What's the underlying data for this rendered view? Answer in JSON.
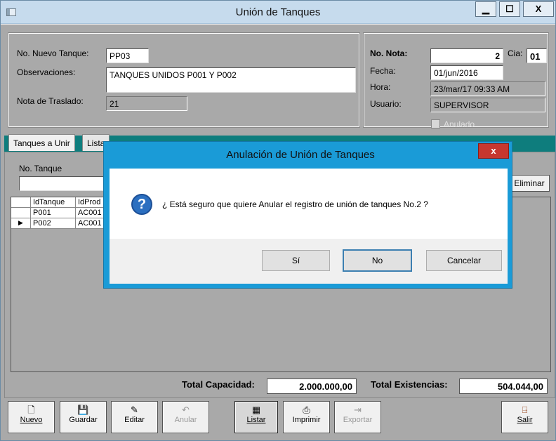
{
  "window": {
    "title": "Unión de Tanques",
    "minimize": "▁",
    "maximize": "☐",
    "close": "X"
  },
  "header": {
    "nuevo_tanque_label": "No. Nuevo Tanque:",
    "nuevo_tanque_value": "PP03",
    "observaciones_label": "Observaciones:",
    "observaciones_value": "TANQUES UNIDOS P001 Y P002",
    "nota_traslado_label": "Nota de Traslado:",
    "nota_traslado_value": "21"
  },
  "nota": {
    "no_nota_label": "No. Nota:",
    "no_nota_value": "2",
    "cia_label": "Cia:",
    "cia_value": "01",
    "fecha_label": "Fecha:",
    "fecha_value": "01/jun/2016",
    "hora_label": "Hora:",
    "hora_value": "23/mar/17 09:33 AM",
    "usuario_label": "Usuario:",
    "usuario_value": "SUPERVISOR",
    "anulado_label": "Anulado"
  },
  "tabs": [
    {
      "label": "Tanques a Unir"
    },
    {
      "label": "Lista"
    }
  ],
  "tanque": {
    "no_tanque_label": "No. Tanque",
    "eliminar_label": "Eliminar"
  },
  "grid": {
    "columns": [
      "IdTanque",
      "IdProd"
    ],
    "rows": [
      {
        "id": "P001",
        "prod": "AC001"
      },
      {
        "id": "P002",
        "prod": "AC001"
      }
    ]
  },
  "totals": {
    "capacidad_label": "Total Capacidad:",
    "capacidad_value": "2.000.000,00",
    "existencias_label": "Total Existencias:",
    "existencias_value": "504.044,00"
  },
  "toolbar": {
    "nuevo": "Nuevo",
    "guardar": "Guardar",
    "editar": "Editar",
    "anular": "Anular",
    "listar": "Listar",
    "imprimir": "Imprimir",
    "exportar": "Exportar",
    "salir": "Salir"
  },
  "dialog": {
    "title": "Anulación de Unión de Tanques",
    "close": "x",
    "message": "¿ Está seguro que quiere Anular el registro de unión de tanques No.2 ?",
    "yes": "Sí",
    "no": "No",
    "cancel": "Cancelar"
  }
}
